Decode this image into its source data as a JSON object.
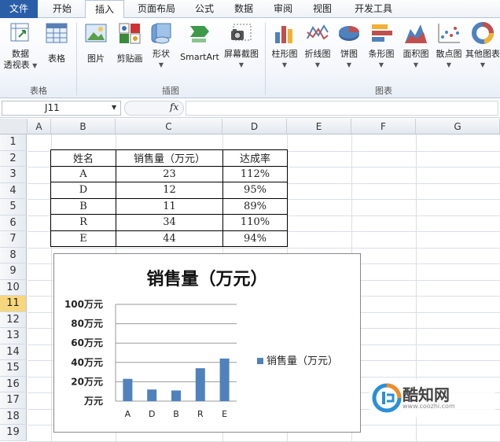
{
  "tabs": [
    {
      "label": "文件"
    },
    {
      "label": "开始"
    },
    {
      "label": "插入"
    },
    {
      "label": "页面布局"
    },
    {
      "label": "公式"
    },
    {
      "label": "数据"
    },
    {
      "label": "审阅"
    },
    {
      "label": "视图"
    },
    {
      "label": "开发工具"
    }
  ],
  "ribbon": {
    "groups": {
      "tables": "表格",
      "illustrations": "插图",
      "charts": "图表"
    },
    "buttons": {
      "pivot": "数据\n透视表",
      "pivot_line1": "数据",
      "pivot_line2": "透视表",
      "table": "表格",
      "picture": "图片",
      "clipart": "剪贴画",
      "shapes": "形状",
      "smartart": "SmartArt",
      "screenshot": "屏幕截图",
      "column": "柱形图",
      "line": "折线图",
      "pie": "饼图",
      "bar": "条形图",
      "area": "面积图",
      "scatter": "散点图",
      "other": "其他图表"
    }
  },
  "formula_bar": {
    "name_box": "J11",
    "fx": "fx",
    "content": ""
  },
  "sheet": {
    "columns": [
      "A",
      "B",
      "C",
      "D",
      "E",
      "F",
      "G"
    ],
    "rows": [
      "1",
      "2",
      "3",
      "4",
      "5",
      "6",
      "7",
      "8",
      "9",
      "10",
      "11",
      "12",
      "13",
      "14",
      "15",
      "16",
      "17",
      "18",
      "19"
    ],
    "selected_row": "11",
    "table": {
      "headers": [
        "姓名",
        "销售量（万元）",
        "达成率"
      ],
      "rows": [
        [
          "A",
          "23",
          "112%"
        ],
        [
          "D",
          "12",
          "95%"
        ],
        [
          "B",
          "11",
          "89%"
        ],
        [
          "R",
          "34",
          "110%"
        ],
        [
          "E",
          "44",
          "94%"
        ]
      ]
    }
  },
  "chart_data": {
    "type": "bar",
    "title": "销售量（万元）",
    "categories": [
      "A",
      "D",
      "B",
      "R",
      "E"
    ],
    "series": [
      {
        "name": "销售量（万元）",
        "values": [
          23,
          12,
          11,
          34,
          44
        ],
        "color": "#4f81bd"
      }
    ],
    "ylim": [
      0,
      100
    ],
    "yticks": [
      "万元",
      "20万元",
      "40万元",
      "60万元",
      "80万元",
      "100万元"
    ],
    "grid": true,
    "legend": "right"
  },
  "watermark": {
    "title": "酷知网",
    "url": "www.coozhi.com"
  }
}
